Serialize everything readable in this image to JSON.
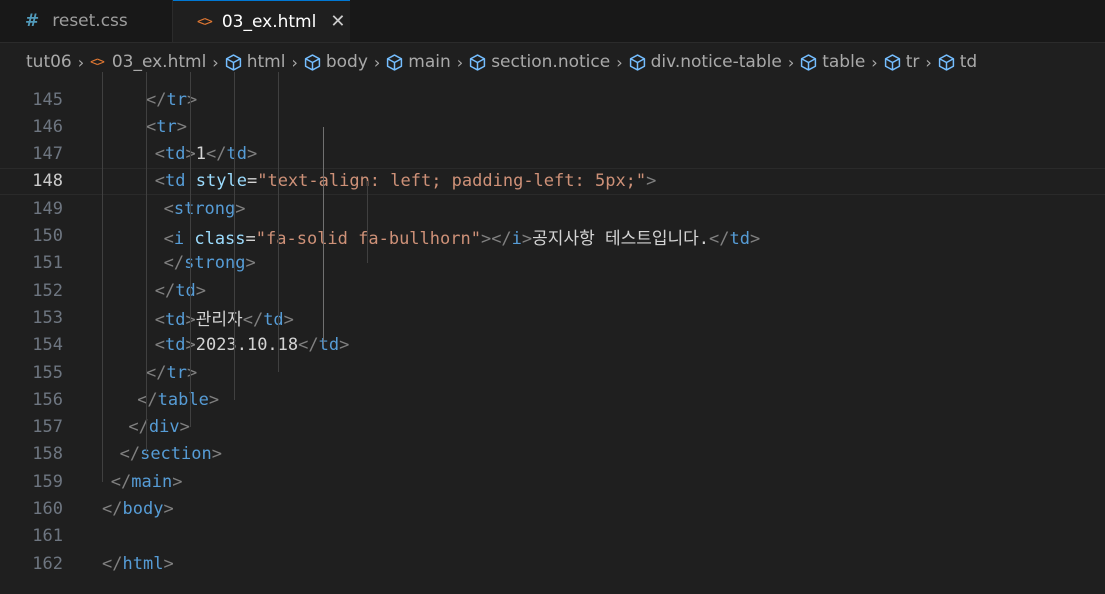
{
  "tabs": [
    {
      "icon": "#",
      "label": "reset.css",
      "active": false
    },
    {
      "icon": "<>",
      "label": "03_ex.html",
      "active": true,
      "close": "✕"
    }
  ],
  "breadcrumb": [
    "tut06",
    "03_ex.html",
    "html",
    "body",
    "main",
    "section.notice",
    "div.notice-table",
    "table",
    "tr",
    "td"
  ],
  "current_line": 148,
  "lines": [
    {
      "n": "145",
      "tokens": [
        [
          "br",
          "</"
        ],
        [
          "tag",
          "tr"
        ],
        [
          "br",
          ">"
        ]
      ]
    },
    {
      "n": "146",
      "tokens": [
        [
          "br",
          "<"
        ],
        [
          "tag",
          "tr"
        ],
        [
          "br",
          ">"
        ]
      ]
    },
    {
      "n": "147",
      "tokens": [
        [
          "br",
          "<"
        ],
        [
          "tag",
          "td"
        ],
        [
          "br",
          ">"
        ],
        [
          "txt",
          "1"
        ],
        [
          "br",
          "</"
        ],
        [
          "tag",
          "td"
        ],
        [
          "br",
          ">"
        ]
      ]
    },
    {
      "n": "148",
      "tokens": [
        [
          "br",
          "<"
        ],
        [
          "tag",
          "td"
        ],
        [
          "txt",
          " "
        ],
        [
          "attr",
          "style"
        ],
        [
          "eq",
          "="
        ],
        [
          "str",
          "\"text-align: left; padding-left: 5px;\""
        ],
        [
          "br",
          ">"
        ]
      ]
    },
    {
      "n": "149",
      "tokens": [
        [
          "br",
          "<"
        ],
        [
          "tag",
          "strong"
        ],
        [
          "br",
          ">"
        ]
      ]
    },
    {
      "n": "150",
      "tokens": [
        [
          "br",
          "<"
        ],
        [
          "tag",
          "i"
        ],
        [
          "txt",
          " "
        ],
        [
          "attr",
          "class"
        ],
        [
          "eq",
          "="
        ],
        [
          "str",
          "\"fa-solid fa-bullhorn\""
        ],
        [
          "br",
          "></"
        ],
        [
          "tag",
          "i"
        ],
        [
          "br",
          ">"
        ],
        [
          "txt",
          "공지사항 테스트입니다."
        ],
        [
          "br",
          "</"
        ],
        [
          "tag",
          "td"
        ],
        [
          "br",
          ">"
        ]
      ]
    },
    {
      "n": "151",
      "tokens": [
        [
          "br",
          "</"
        ],
        [
          "tag",
          "strong"
        ],
        [
          "br",
          ">"
        ]
      ]
    },
    {
      "n": "152",
      "tokens": [
        [
          "br",
          "</"
        ],
        [
          "tag",
          "td"
        ],
        [
          "br",
          ">"
        ]
      ]
    },
    {
      "n": "153",
      "tokens": [
        [
          "br",
          "<"
        ],
        [
          "tag",
          "td"
        ],
        [
          "br",
          ">"
        ],
        [
          "txt",
          "관리자"
        ],
        [
          "br",
          "</"
        ],
        [
          "tag",
          "td"
        ],
        [
          "br",
          ">"
        ]
      ]
    },
    {
      "n": "154",
      "tokens": [
        [
          "br",
          "<"
        ],
        [
          "tag",
          "td"
        ],
        [
          "br",
          ">"
        ],
        [
          "txt",
          "2023.10.18"
        ],
        [
          "br",
          "</"
        ],
        [
          "tag",
          "td"
        ],
        [
          "br",
          ">"
        ]
      ]
    },
    {
      "n": "155",
      "tokens": [
        [
          "br",
          "</"
        ],
        [
          "tag",
          "tr"
        ],
        [
          "br",
          ">"
        ]
      ]
    },
    {
      "n": "156",
      "tokens": [
        [
          "br",
          "</"
        ],
        [
          "tag",
          "table"
        ],
        [
          "br",
          ">"
        ]
      ]
    },
    {
      "n": "157",
      "tokens": [
        [
          "br",
          "</"
        ],
        [
          "tag",
          "div"
        ],
        [
          "br",
          ">"
        ]
      ]
    },
    {
      "n": "158",
      "tokens": [
        [
          "br",
          "</"
        ],
        [
          "tag",
          "section"
        ],
        [
          "br",
          ">"
        ]
      ]
    },
    {
      "n": "159",
      "tokens": [
        [
          "br",
          "</"
        ],
        [
          "tag",
          "main"
        ],
        [
          "br",
          ">"
        ]
      ]
    },
    {
      "n": "160",
      "tokens": [
        [
          "br",
          "</"
        ],
        [
          "tag",
          "body"
        ],
        [
          "br",
          ">"
        ]
      ]
    },
    {
      "n": "161",
      "tokens": []
    },
    {
      "n": "162",
      "tokens": [
        [
          "br",
          "</"
        ],
        [
          "tag",
          "html"
        ],
        [
          "br",
          ">"
        ]
      ]
    }
  ],
  "colors": {
    "background": "#1f1f1f",
    "tag": "#569cd6",
    "attribute": "#9cdcfe",
    "string": "#ce9178",
    "bracket": "#808080",
    "accent": "#0078d4"
  }
}
